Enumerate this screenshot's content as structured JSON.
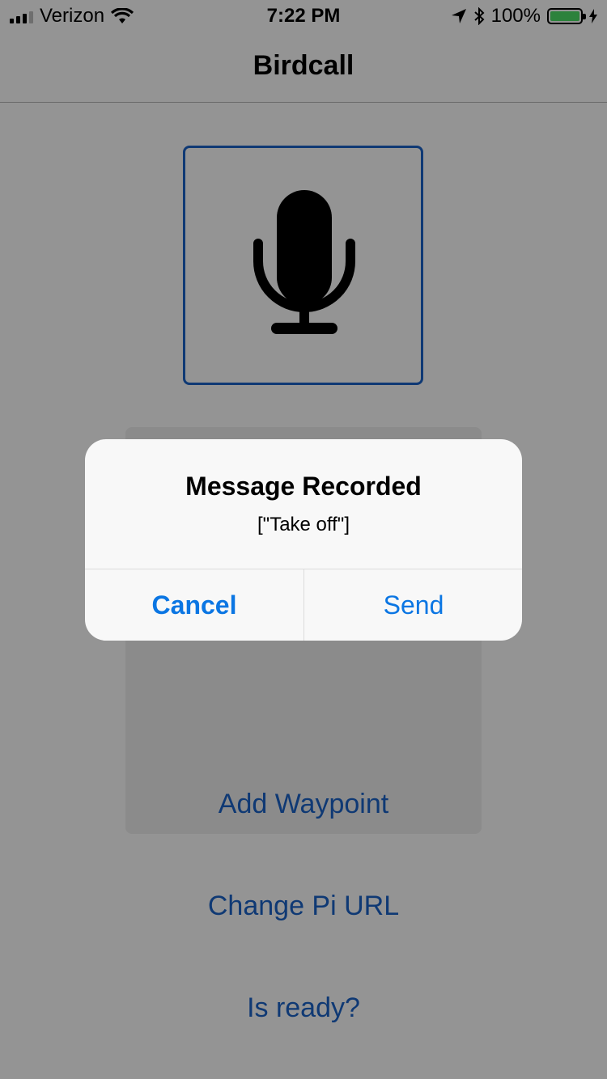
{
  "status_bar": {
    "carrier": "Verizon",
    "time": "7:22 PM",
    "battery": "100%",
    "battery_level": 1.0
  },
  "nav": {
    "title": "Birdcall"
  },
  "main": {
    "mic_icon": "microphone-icon",
    "add_waypoint_label": "Add Waypoint",
    "change_url_label": "Change Pi URL",
    "is_ready_label": "Is ready?"
  },
  "alert": {
    "title": "Message Recorded",
    "message": "[\"Take off\"]",
    "cancel_label": "Cancel",
    "send_label": "Send"
  },
  "colors": {
    "accent": "#1a5fc2",
    "alert_button": "#0b76e3",
    "battery": "#4cd964"
  }
}
